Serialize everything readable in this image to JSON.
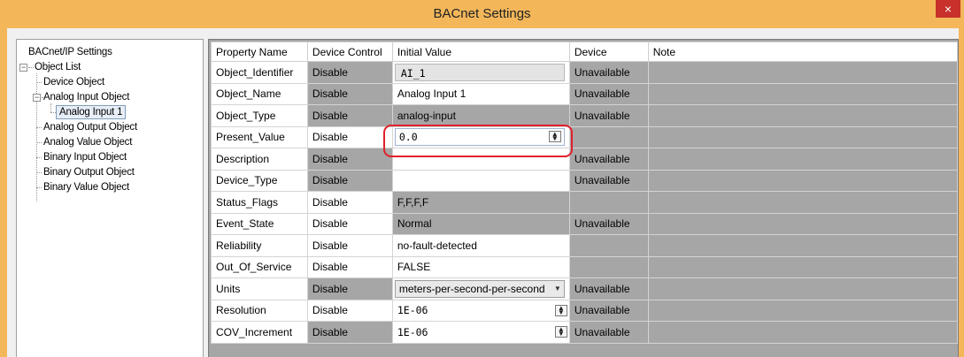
{
  "window": {
    "title": "BACnet Settings",
    "close_label": "×"
  },
  "tree": {
    "root": "BACnet/IP Settings",
    "object_list": "Object List",
    "items": [
      "Device Object",
      "Analog Input Object",
      "Analog Input 1",
      "Analog Output Object",
      "Analog Value Object",
      "Binary Input Object",
      "Binary Output Object",
      "Binary Value Object"
    ]
  },
  "grid": {
    "headers": [
      "Property Name",
      "Device Control",
      "Initial Value",
      "Device",
      "Note"
    ],
    "rows": [
      {
        "name": "Object_Identifier",
        "control": "Disable",
        "value": "AI_1",
        "device": "Unavailable"
      },
      {
        "name": "Object_Name",
        "control": "Disable",
        "value": "Analog Input 1",
        "device": "Unavailable"
      },
      {
        "name": "Object_Type",
        "control": "Disable",
        "value": "analog-input",
        "device": "Unavailable"
      },
      {
        "name": "Present_Value",
        "control": "Disable",
        "value": "0.0",
        "device": ""
      },
      {
        "name": "Description",
        "control": "Disable",
        "value": "",
        "device": "Unavailable"
      },
      {
        "name": "Device_Type",
        "control": "Disable",
        "value": "",
        "device": "Unavailable"
      },
      {
        "name": "Status_Flags",
        "control": "Disable",
        "value": "F,F,F,F",
        "device": ""
      },
      {
        "name": "Event_State",
        "control": "Disable",
        "value": "Normal",
        "device": "Unavailable"
      },
      {
        "name": "Reliability",
        "control": "Disable",
        "value": "no-fault-detected",
        "device": ""
      },
      {
        "name": "Out_Of_Service",
        "control": "Disable",
        "value": "FALSE",
        "device": ""
      },
      {
        "name": "Units",
        "control": "Disable",
        "value": "meters-per-second-per-second",
        "device": "Unavailable"
      },
      {
        "name": "Resolution",
        "control": "Disable",
        "value": "1E-06",
        "device": "Unavailable"
      },
      {
        "name": "COV_Increment",
        "control": "Disable",
        "value": "1E-06",
        "device": "Unavailable"
      }
    ]
  },
  "colors": {
    "title_bar": "#f3b75a",
    "close_button": "#c7302b",
    "highlight_ring": "#e0202a",
    "disabled_cell": "#a6a6a6"
  }
}
